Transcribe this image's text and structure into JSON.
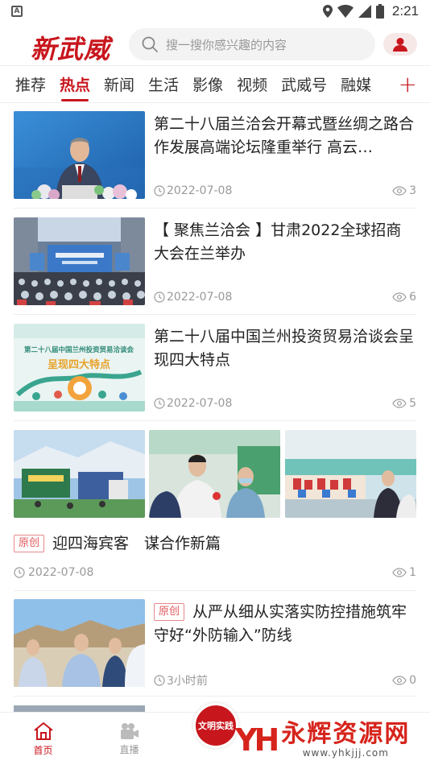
{
  "statusbar": {
    "app_icon": "A",
    "time": "2:21"
  },
  "header": {
    "logo": "新武威",
    "search_placeholder": "搜一搜你感兴趣的内容"
  },
  "tabs": [
    {
      "label": "推荐",
      "active": false
    },
    {
      "label": "热点",
      "active": true
    },
    {
      "label": "新闻",
      "active": false
    },
    {
      "label": "生活",
      "active": false
    },
    {
      "label": "影像",
      "active": false
    },
    {
      "label": "视频",
      "active": false
    },
    {
      "label": "武威号",
      "active": false
    },
    {
      "label": "融媒",
      "active": false
    }
  ],
  "tab_add": "+",
  "news": [
    {
      "title": "第二十八届兰洽会开幕式暨丝绸之路合作发展高端论坛隆重举行 高云…",
      "time": "2022-07-08",
      "views": "3"
    },
    {
      "title": "【 聚焦兰洽会 】甘肃2022全球招商大会在兰举办",
      "time": "2022-07-08",
      "views": "6"
    },
    {
      "title": "第二十八届中国兰州投资贸易洽谈会呈现四大特点",
      "time": "2022-07-08",
      "views": "5"
    }
  ],
  "gallery_item": {
    "badge": "原创",
    "title": "迎四海宾客　谋合作新篇",
    "time": "2022-07-08",
    "views": "1"
  },
  "news4": {
    "badge": "原创",
    "title": "从严从细从实落实防控措施筑牢守好“外防输入”防线",
    "time": "3小时前",
    "views": "0"
  },
  "image_text": {
    "banner": "第二十八届中国兰州投资贸易洽谈会",
    "subtitle": "呈现四大特点"
  },
  "bottom_nav": {
    "home": "首页",
    "live": "直播",
    "center_badge": "文明实践"
  },
  "watermark": {
    "cn": "永辉资源网",
    "url": "www.yhkjjj.com",
    "logo": "YH"
  },
  "colors": {
    "brand": "#c8161d",
    "muted": "#999999"
  }
}
